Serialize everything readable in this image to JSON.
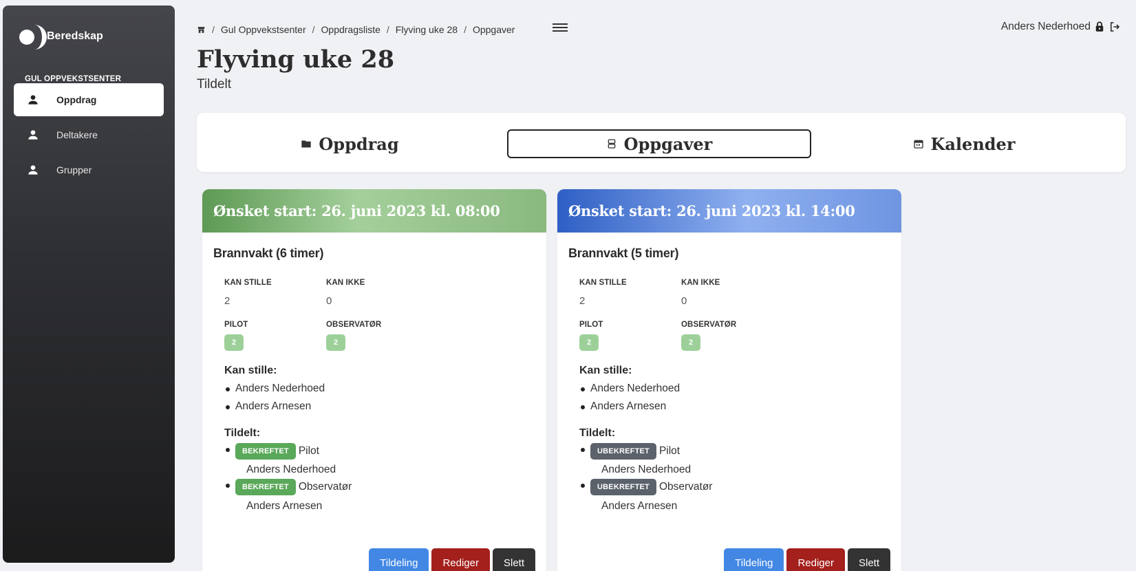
{
  "sidebar": {
    "brand": "Beredskap",
    "section": "GUL OPPVEKSTSENTER",
    "items": [
      {
        "label": "Oppdrag",
        "icon": "person-icon",
        "active": true
      },
      {
        "label": "Deltakere",
        "icon": "person-icon",
        "active": false
      },
      {
        "label": "Grupper",
        "icon": "person-icon",
        "active": false
      }
    ]
  },
  "breadcrumb": [
    "Gul Oppvekstsenter",
    "Oppdragsliste",
    "Flyving uke 28",
    "Oppgaver"
  ],
  "user": {
    "name": "Anders Nederhoed"
  },
  "page": {
    "title": "Flyving uke 28",
    "subtitle": "Tildelt"
  },
  "tabs": [
    {
      "label": "Oppdrag",
      "icon": "folder-icon"
    },
    {
      "label": "Oppgaver",
      "icon": "list-icon",
      "active": true
    },
    {
      "label": "Kalender",
      "icon": "calendar-icon"
    }
  ],
  "cards": [
    {
      "header": "Ønsket start: 26. juni 2023 kl. 08:00",
      "task": "Brannvakt (6 timer)",
      "stats": {
        "kan_stille_label": "KAN STILLE",
        "kan_stille": "2",
        "kan_ikke_label": "KAN IKKE",
        "kan_ikke": "0",
        "pilot_label": "PILOT",
        "pilot": "2",
        "observator_label": "OBSERVATØR",
        "observator": "2"
      },
      "kan_stille_title": "Kan stille:",
      "kan_stille_list": [
        "Anders Nederhoed",
        "Anders Arnesen"
      ],
      "tildelt_title": "Tildelt:",
      "tildelt": [
        {
          "status": "BEKREFTET",
          "role": "Pilot",
          "name": "Anders Nederhoed"
        },
        {
          "status": "BEKREFTET",
          "role": "Observatør",
          "name": "Anders Arnesen"
        }
      ],
      "buttons": {
        "assign": "Tildeling",
        "edit": "Rediger",
        "delete": "Slett"
      }
    },
    {
      "header": "Ønsket start: 26. juni 2023 kl. 14:00",
      "task": "Brannvakt (5 timer)",
      "stats": {
        "kan_stille_label": "KAN STILLE",
        "kan_stille": "2",
        "kan_ikke_label": "KAN IKKE",
        "kan_ikke": "0",
        "pilot_label": "PILOT",
        "pilot": "2",
        "observator_label": "OBSERVATØR",
        "observator": "2"
      },
      "kan_stille_title": "Kan stille:",
      "kan_stille_list": [
        "Anders Nederhoed",
        "Anders Arnesen"
      ],
      "tildelt_title": "Tildelt:",
      "tildelt": [
        {
          "status": "UBEKREFTET",
          "role": "Pilot",
          "name": "Anders Nederhoed"
        },
        {
          "status": "UBEKREFTET",
          "role": "Observatør",
          "name": "Anders Arnesen"
        }
      ],
      "buttons": {
        "assign": "Tildeling",
        "edit": "Rediger",
        "delete": "Slett"
      }
    }
  ],
  "colors": {
    "confirmed": "#5aa85a",
    "unconfirmed": "#5b626b",
    "assign": "#4287e4",
    "edit": "#a3201c",
    "delete": "#333333"
  }
}
